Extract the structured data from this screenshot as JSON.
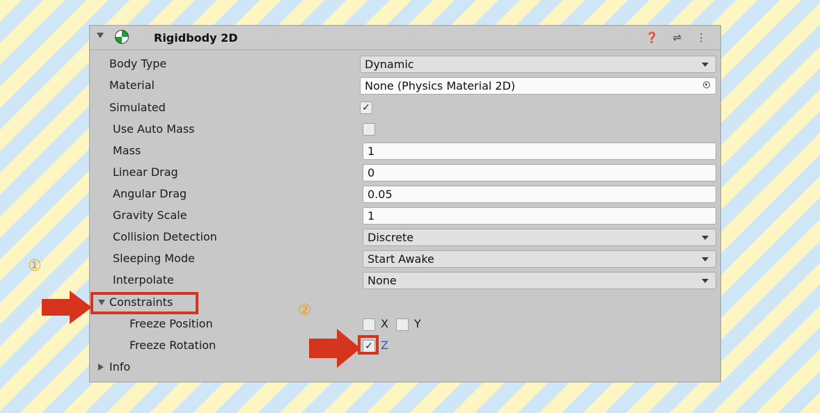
{
  "component": {
    "title": "Rigidbody 2D",
    "header_icons": "❓ ⇌ ⋮"
  },
  "rows": {
    "body_type": {
      "label": "Body Type",
      "value": "Dynamic"
    },
    "material": {
      "label": "Material",
      "value": "None (Physics Material 2D)"
    },
    "simulated": {
      "label": "Simulated",
      "checked": true,
      "check_glyph": "✓"
    },
    "use_auto_mass": {
      "label": "Use Auto Mass",
      "checked": false
    },
    "mass": {
      "label": "Mass",
      "value": "1"
    },
    "linear_drag": {
      "label": "Linear Drag",
      "value": "0"
    },
    "angular_drag": {
      "label": "Angular Drag",
      "value": "0.05"
    },
    "gravity_scale": {
      "label": "Gravity Scale",
      "value": "1"
    },
    "collision_detection": {
      "label": "Collision Detection",
      "value": "Discrete"
    },
    "sleeping_mode": {
      "label": "Sleeping Mode",
      "value": "Start Awake"
    },
    "interpolate": {
      "label": "Interpolate",
      "value": "None"
    },
    "constraints": {
      "label": "Constraints"
    },
    "freeze_position": {
      "label": "Freeze Position",
      "x_label": "X",
      "y_label": "Y",
      "x_checked": false,
      "y_checked": false
    },
    "freeze_rotation": {
      "label": "Freeze Rotation",
      "z_label": "Z",
      "z_checked": true,
      "check_glyph": "✓"
    },
    "info": {
      "label": "Info"
    }
  },
  "annotations": {
    "marker_1": "①",
    "marker_2": "②",
    "highlight_color": "#d6341d",
    "marker_color": "#e8a000"
  },
  "colors": {
    "panel_bg": "#c8c8c8",
    "stripe_yellow": "#fdf6c3",
    "stripe_blue": "#cfe6f6"
  }
}
